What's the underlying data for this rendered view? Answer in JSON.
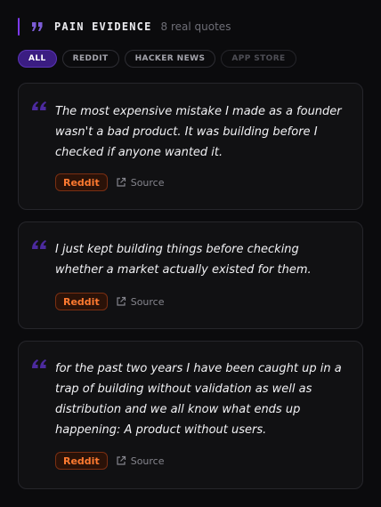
{
  "header": {
    "title": "PAIN EVIDENCE",
    "count": "8 real quotes",
    "icon": "quote-icon",
    "accent": "#7c3aed"
  },
  "tabs": [
    {
      "label": "ALL",
      "active": true
    },
    {
      "label": "REDDIT",
      "active": false
    },
    {
      "label": "HACKER NEWS",
      "active": false
    },
    {
      "label": "APP STORE",
      "active": false
    }
  ],
  "quotes": [
    {
      "text": "The most expensive mistake I made as a founder wasn't a bad product. It was building before I checked if anyone wanted it.",
      "source_badge": "Reddit",
      "source_link": "Source"
    },
    {
      "text": "I just kept building things before checking whether a market actually existed for them.",
      "source_badge": "Reddit",
      "source_link": "Source"
    },
    {
      "text": "for the past two years I have been caught up in a trap of building without validation as well as distribution and we all know what ends up happening: A product without users.",
      "source_badge": "Reddit",
      "source_link": "Source"
    }
  ],
  "colors": {
    "background": "#0b0b0d",
    "card_background": "#111113",
    "quote_mark": "#4c2a9e",
    "reddit_badge": "#ff7a30"
  }
}
